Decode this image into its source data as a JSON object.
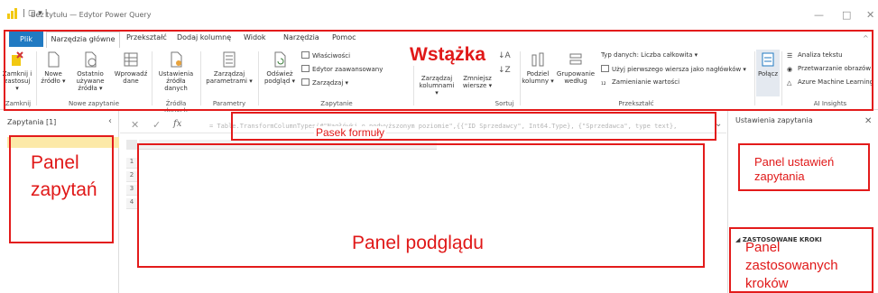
{
  "window": {
    "title": "Bez tytułu — Edytor Power Query",
    "minimize": "—",
    "maximize": "□",
    "close": "✕"
  },
  "tabs": [
    "Plik",
    "Narzędzia główne",
    "Przekształć",
    "Dodaj kolumnę",
    "Widok",
    "Narzędzia",
    "Pomoc"
  ],
  "ribbon": {
    "close_btn": "Zamknij i zastosuj ▾",
    "new_source": "Nowe źródło ▾",
    "recent_sources": "Ostatnio używane źródła ▾",
    "enter_data": "Wprowadź dane",
    "source_settings": "Ustawienia źródła danych",
    "manage_params": "Zarządzaj parametrami ▾",
    "refresh_preview": "Odśwież podgląd ▾",
    "properties": "Właściwości",
    "advanced_editor": "Edytor zaawansowany",
    "manage": "Zarządzaj ▾",
    "manage_columns": "Zarządzaj kolumnami ▾",
    "reduce_rows": "Zmniejsz wiersze ▾",
    "split_column": "Podziel kolumny ▾",
    "group_by": "Grupowanie według",
    "data_type": "Typ danych: Liczba całkowita ▾",
    "first_row_headers": "Użyj pierwszego wiersza jako nagłówków ▾",
    "replace_values": "Zamienianie wartości",
    "combine": "Połącz",
    "text_analytics": "Analiza tekstu",
    "vision": "Przetwarzanie obrazów",
    "azure_ml": "Azure Machine Learning",
    "groups": {
      "close": "Zamknij",
      "new_query": "Nowe zapytanie",
      "data_sources": "Źródła danych",
      "parameters": "Parametry",
      "query": "Zapytanie",
      "sort": "Sortuj",
      "transform": "Przekształć",
      "ai_insights": "AI Insights"
    }
  },
  "formula_bar": {
    "cancel": "✕",
    "confirm": "✓",
    "fx": "fx",
    "text": "= Table.TransformColumnTypes(#\"Nagłówki o podwyższonym poziomie\",{{\"ID Sprzedawcy\", Int64.Type}, {\"Sprzedawca\", type text},",
    "expand": "⌄"
  },
  "queries_panel": {
    "title": "Zapytania [1]",
    "collapse": "‹"
  },
  "preview": {
    "row_numbers": [
      "1",
      "2",
      "3",
      "4"
    ]
  },
  "settings_panel": {
    "title": "Ustawienia zapytania",
    "close": "✕",
    "applied_steps": "◢ ZASTOSOWANE KROKI"
  },
  "annotations": {
    "ribbon": "Wstążka",
    "formula": "Pasek formuły",
    "queries": "Panel zapytań",
    "preview": "Panel podglądu",
    "settings": "Panel ustawień zapytania",
    "steps": "Panel zastosowanych kroków"
  },
  "colors": {
    "accent": "#217ac2",
    "annotation": "#e31b1b",
    "brand": "#f2c811"
  }
}
